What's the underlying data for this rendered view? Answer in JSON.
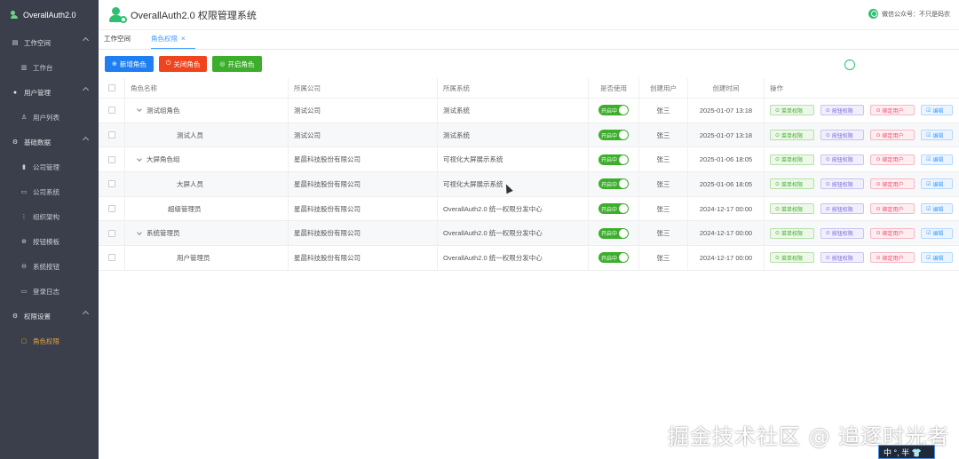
{
  "app": {
    "name": "OverallAuth2.0",
    "title": "OverallAuth2.0 权限管理系统",
    "wechat": "微信公众号：不只是码农"
  },
  "sidebar": [
    {
      "group": "工作空间",
      "icon": "file-icon",
      "glyph": "▤",
      "items": [
        {
          "label": "工作台",
          "glyph": "▥"
        }
      ]
    },
    {
      "group": "用户管理",
      "icon": "user-icon",
      "glyph": "●",
      "items": [
        {
          "label": "用户列表",
          "glyph": "♙"
        }
      ]
    },
    {
      "group": "基础数据",
      "icon": "gear-icon",
      "glyph": "⚙",
      "items": [
        {
          "label": "公司管理",
          "glyph": "▮"
        },
        {
          "label": "公司系统",
          "glyph": "▭"
        },
        {
          "label": "组织架构",
          "glyph": "⋮"
        },
        {
          "label": "按钮模板",
          "glyph": "⊕"
        },
        {
          "label": "系统按钮",
          "glyph": "⊖"
        },
        {
          "label": "登录日志",
          "glyph": "▭"
        }
      ]
    },
    {
      "group": "权限设置",
      "icon": "gear-icon",
      "glyph": "⚙",
      "items": [
        {
          "label": "角色权限",
          "glyph": "▢",
          "active": true
        }
      ]
    }
  ],
  "tabs": [
    {
      "label": "工作空间"
    },
    {
      "label": "角色权限",
      "active": true,
      "close": "×"
    }
  ],
  "toolbar": {
    "add": "新增角色",
    "close": "关闭角色",
    "open": "开启角色",
    "add_glyph": "⊕",
    "close_glyph": "⏻",
    "open_glyph": "◎"
  },
  "table": {
    "headers": {
      "name": "角色名称",
      "company": "所属公司",
      "system": "所属系统",
      "use": "是否使用",
      "user": "创建用户",
      "time": "创建时间",
      "ops": "操作"
    },
    "rows": [
      {
        "name": "测试组角色",
        "level": 0,
        "caret": true,
        "company": "测试公司",
        "system": "测试系统",
        "use": "开启中",
        "user": "张三",
        "time": "2025-01-07 13:18"
      },
      {
        "name": "测试人员",
        "level": 1,
        "caret": false,
        "company": "测试公司",
        "system": "测试系统",
        "use": "开启中",
        "user": "张三",
        "time": "2025-01-07 13:18"
      },
      {
        "name": "大屏角色组",
        "level": 0,
        "caret": true,
        "company": "星晨科技股份有限公司",
        "system": "可视化大屏展示系统",
        "use": "开启中",
        "user": "张三",
        "time": "2025-01-06 18:05"
      },
      {
        "name": "大屏人员",
        "level": 1,
        "caret": false,
        "company": "星晨科技股份有限公司",
        "system": "可视化大屏展示系统",
        "use": "开启中",
        "user": "张三",
        "time": "2025-01-06 18:05"
      },
      {
        "name": "超级管理员",
        "level": 2,
        "caret": false,
        "company": "星晨科技股份有限公司",
        "system": "OverallAuth2.0 统一权限分发中心",
        "use": "开启中",
        "user": "张三",
        "time": "2024-12-17 00:00"
      },
      {
        "name": "系统管理员",
        "level": 0,
        "caret": true,
        "company": "星晨科技股份有限公司",
        "system": "OverallAuth2.0 统一权限分发中心",
        "use": "开启中",
        "user": "张三",
        "time": "2024-12-17 00:00"
      },
      {
        "name": "用户管理员",
        "level": 1,
        "caret": false,
        "company": "星晨科技股份有限公司",
        "system": "OverallAuth2.0 统一权限分发中心",
        "use": "开启中",
        "user": "张三",
        "time": "2024-12-17 00:00"
      }
    ],
    "ops": {
      "menu": "菜单权限",
      "btn": "按钮权限",
      "bind": "绑定用户",
      "edit": "编辑",
      "menu_glyph": "⊙",
      "btn_glyph": "⊙",
      "bind_glyph": "⊙",
      "edit_glyph": "☑"
    }
  },
  "overlay": {
    "watermark": "掘金技术社区 @ 追逐时光者",
    "ime": "中 °, 半 👕"
  }
}
